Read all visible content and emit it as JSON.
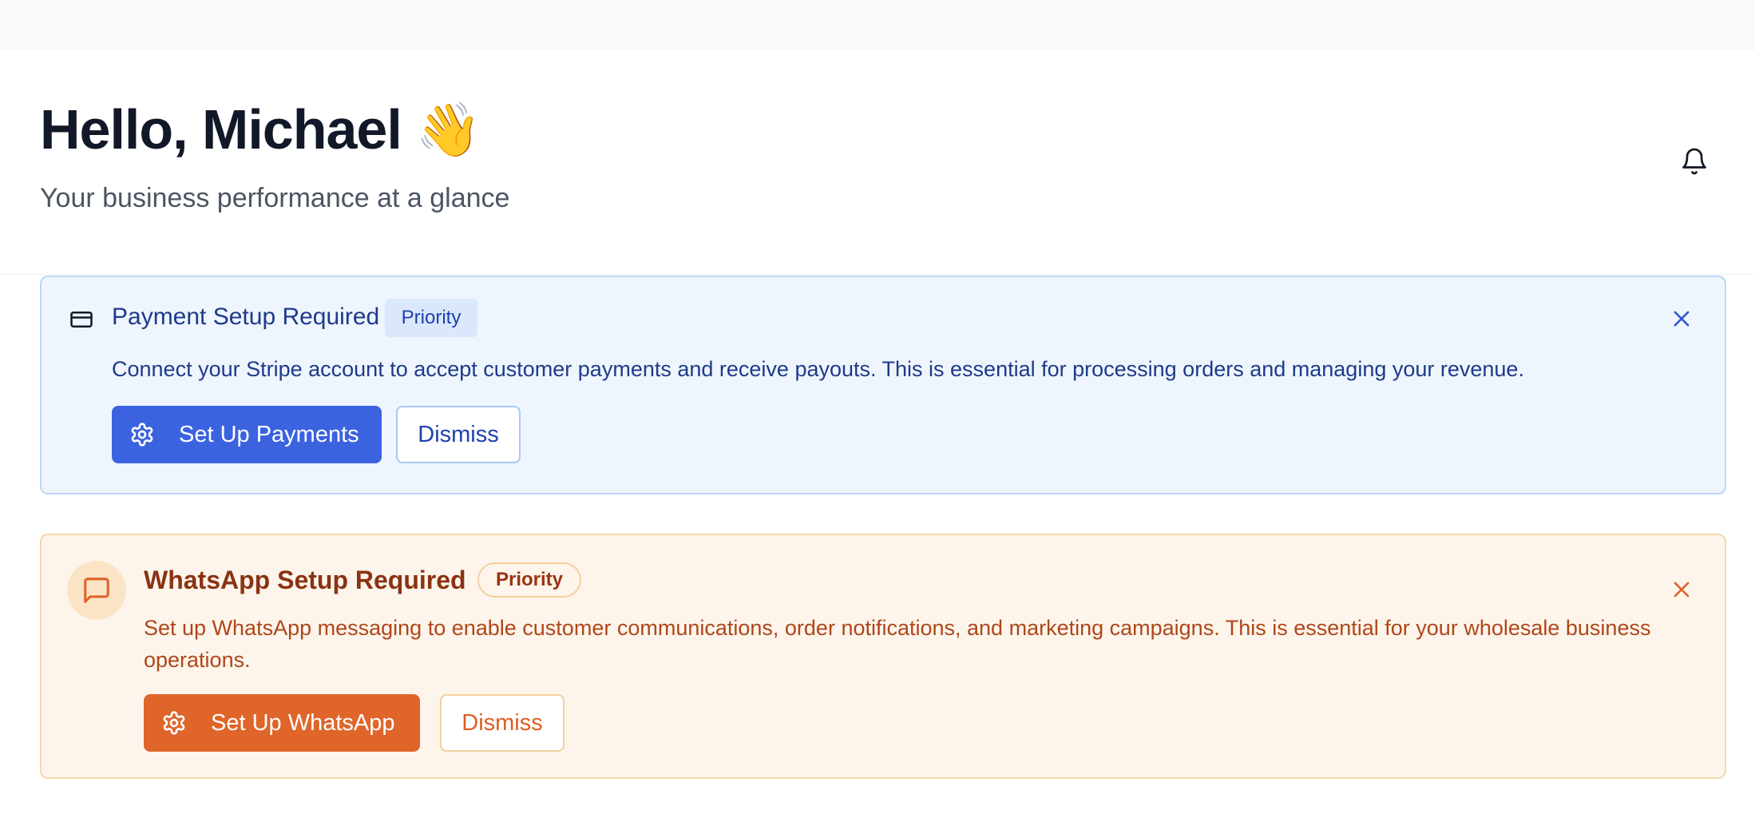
{
  "header": {
    "greeting": "Hello, Michael",
    "wave_emoji": "👋",
    "subtitle": "Your business performance at a glance",
    "notification_icon": "bell-icon"
  },
  "alerts": [
    {
      "id": "payment",
      "icon": "credit-card-icon",
      "title": "Payment Setup Required",
      "badge": "Priority",
      "description": "Connect your Stripe account to accept customer payments and receive payouts. This is essential for processing orders and managing your revenue.",
      "primary_label": "Set Up Payments",
      "primary_icon": "gear-icon",
      "secondary_label": "Dismiss",
      "close_icon": "close-icon",
      "colors": {
        "background": "#eef5fd",
        "border": "#bdd7f3",
        "accent": "#3b63e0",
        "text": "#1e3a8a"
      }
    },
    {
      "id": "whatsapp",
      "icon": "message-square-icon",
      "title": "WhatsApp Setup Required",
      "badge": "Priority",
      "description": "Set up WhatsApp messaging to enable customer communications, order notifications, and marketing campaigns. This is essential for your wholesale business operations.",
      "primary_label": "Set Up WhatsApp",
      "primary_icon": "gear-icon",
      "secondary_label": "Dismiss",
      "close_icon": "close-icon",
      "colors": {
        "background": "#fdf5eb",
        "border": "#f6d8ad",
        "accent": "#df652a",
        "text": "#8a3312"
      }
    }
  ]
}
